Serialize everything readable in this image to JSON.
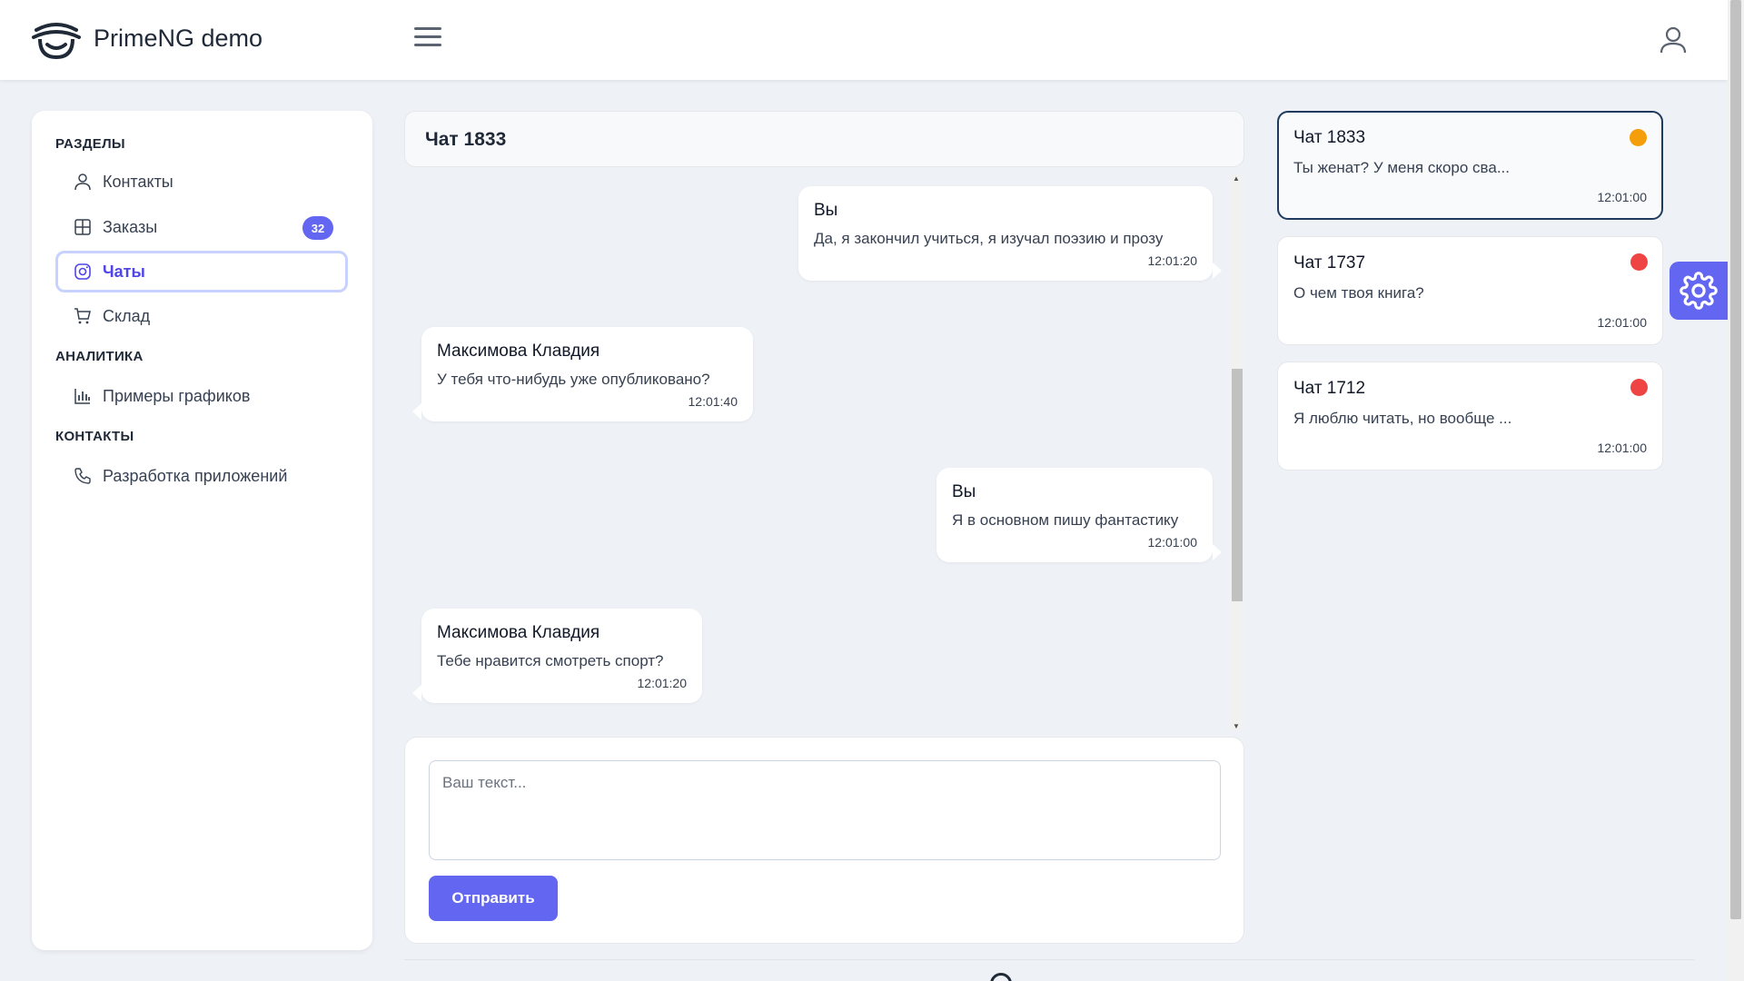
{
  "app": {
    "title": "PrimeNG demo"
  },
  "sidebar": {
    "sections": [
      {
        "title": "РАЗДЕЛЫ"
      },
      {
        "title": "АНАЛИТИКА"
      },
      {
        "title": "КОНТАКТЫ"
      }
    ],
    "items": [
      {
        "label": "Контакты",
        "icon": "user-icon"
      },
      {
        "label": "Заказы",
        "icon": "table-icon",
        "badge": "32"
      },
      {
        "label": "Чаты",
        "icon": "instagram-icon",
        "active": true
      },
      {
        "label": "Склад",
        "icon": "cart-icon"
      },
      {
        "label": "Примеры графиков",
        "icon": "chart-bar-icon"
      },
      {
        "label": "Разработка приложений",
        "icon": "phone-icon"
      }
    ]
  },
  "chat": {
    "title": "Чат 1833",
    "messages": [
      {
        "author": "Вы",
        "text": "Да, я закончил учиться, я изучал поэзию и прозу",
        "time": "12:01:20",
        "side": "right"
      },
      {
        "author": "Максимова Клавдия",
        "text": "У тебя что-нибудь уже опубликовано?",
        "time": "12:01:40",
        "side": "left"
      },
      {
        "author": "Вы",
        "text": "Я в основном пишу фантастику",
        "time": "12:01:00",
        "side": "right"
      },
      {
        "author": "Максимова Клавдия",
        "text": "Тебе нравится смотреть спорт?",
        "time": "12:01:20",
        "side": "left"
      }
    ],
    "input_placeholder": "Ваш текст...",
    "send_label": "Отправить"
  },
  "chat_list": [
    {
      "title": "Чат 1833",
      "preview": "Ты женат? У меня скоро сва...",
      "time": "12:01:00",
      "status_color": "#f59e0b",
      "active": true
    },
    {
      "title": "Чат 1737",
      "preview": "О чем твоя книга?",
      "time": "12:01:00",
      "status_color": "#ef4444"
    },
    {
      "title": "Чат 1712",
      "preview": "Я люблю читать, но вообще ...",
      "time": "12:01:00",
      "status_color": "#ef4444"
    }
  ],
  "colors": {
    "accent": "#6366f1",
    "background": "#eef1f6"
  }
}
